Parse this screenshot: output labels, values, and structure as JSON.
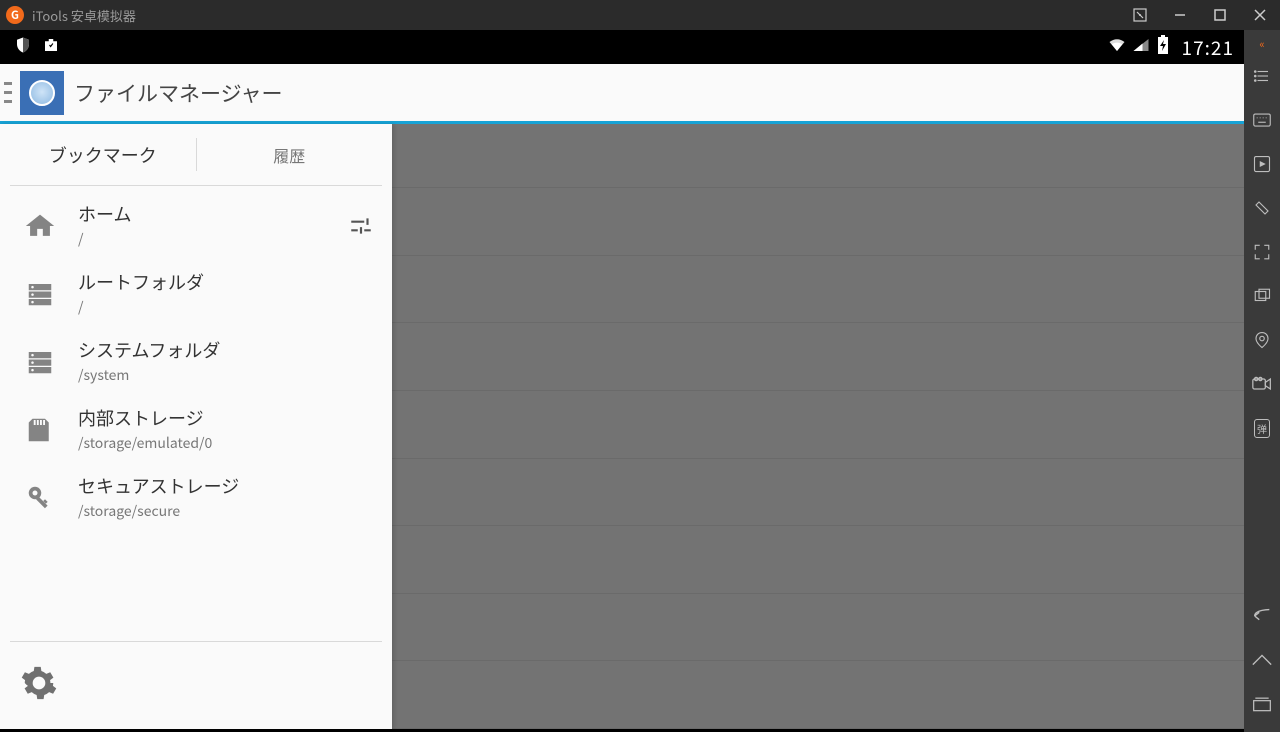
{
  "window": {
    "title": "iTools 安卓模拟器"
  },
  "statusbar": {
    "time": "17:21"
  },
  "app": {
    "title": "ファイルマネージャー"
  },
  "tabs": {
    "bookmarks": "ブックマーク",
    "history": "履歴"
  },
  "items": [
    {
      "label": "ホーム",
      "path": "/"
    },
    {
      "label": "ルートフォルダ",
      "path": "/"
    },
    {
      "label": "システムフォルダ",
      "path": "/system"
    },
    {
      "label": "内部ストレージ",
      "path": "/storage/emulated/0"
    },
    {
      "label": "セキュアストレージ",
      "path": "/storage/secure"
    }
  ],
  "right_toolbar": {
    "danmu": "弹"
  }
}
